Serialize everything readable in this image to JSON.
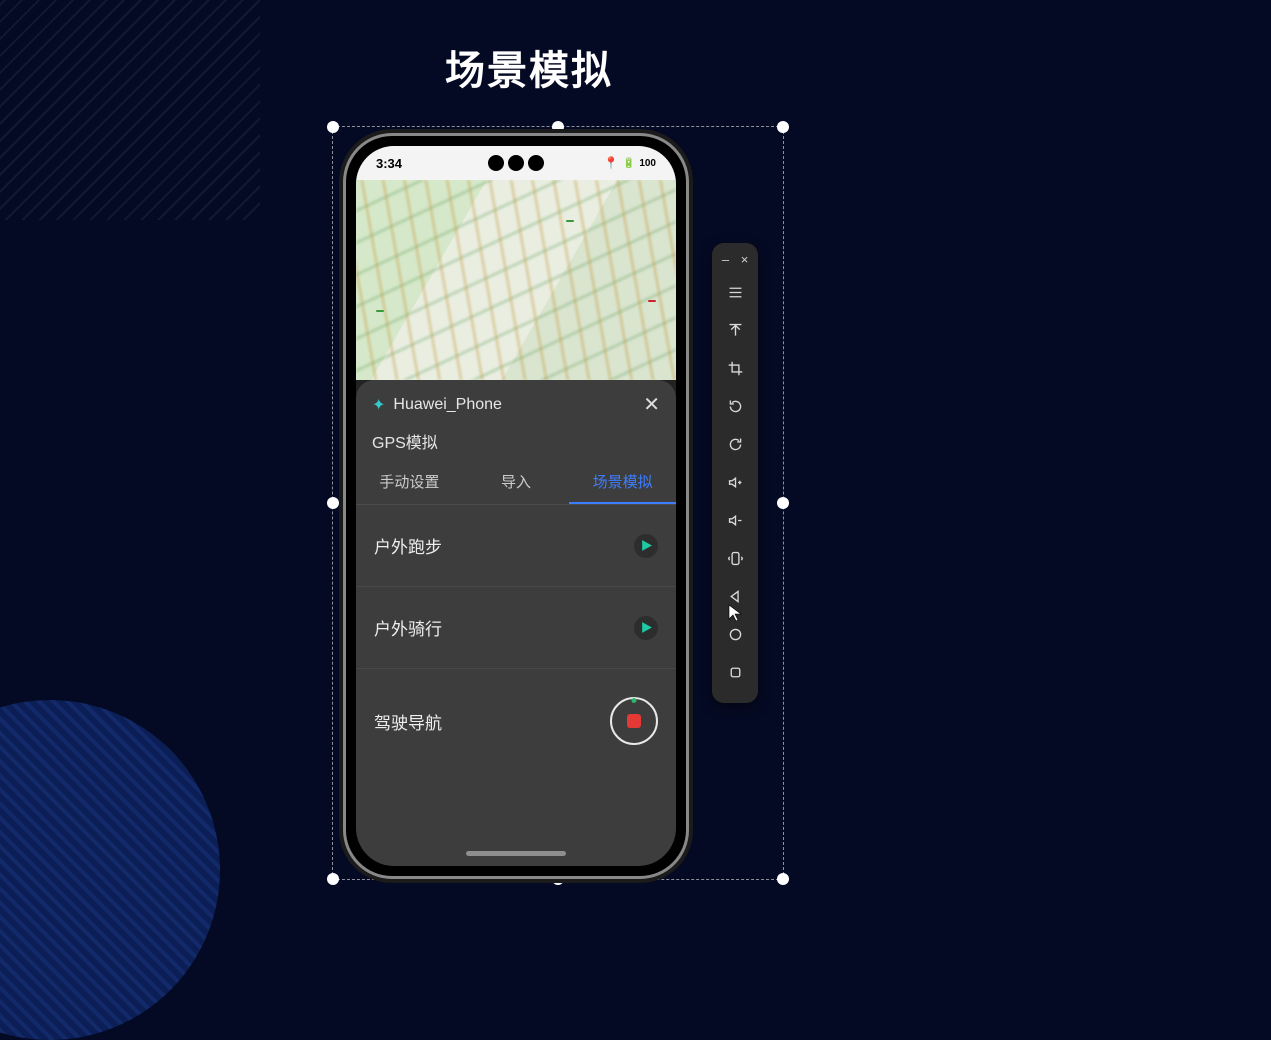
{
  "page": {
    "title": "场景模拟"
  },
  "statusbar": {
    "time": "3:34",
    "location_icon": "📍",
    "battery": "100"
  },
  "panel": {
    "device_name": "Huawei_Phone",
    "subtitle": "GPS模拟",
    "tabs": [
      {
        "label": "手动设置",
        "active": false
      },
      {
        "label": "导入",
        "active": false
      },
      {
        "label": "场景模拟",
        "active": true
      }
    ],
    "rows": [
      {
        "label": "户外跑步",
        "action": "play"
      },
      {
        "label": "户外骑行",
        "action": "play"
      },
      {
        "label": "驾驶导航",
        "action": "record"
      }
    ]
  },
  "sidebar": {
    "window": {
      "minimize": "–",
      "close": "×"
    },
    "items": [
      {
        "name": "menu-icon"
      },
      {
        "name": "upload-icon"
      },
      {
        "name": "crop-icon"
      },
      {
        "name": "rotate-ccw-icon"
      },
      {
        "name": "rotate-cw-icon"
      },
      {
        "name": "volume-up-icon"
      },
      {
        "name": "volume-down-icon"
      },
      {
        "name": "shake-icon"
      },
      {
        "name": "nav-back-icon"
      },
      {
        "name": "nav-home-icon"
      },
      {
        "name": "nav-recent-icon"
      }
    ]
  }
}
